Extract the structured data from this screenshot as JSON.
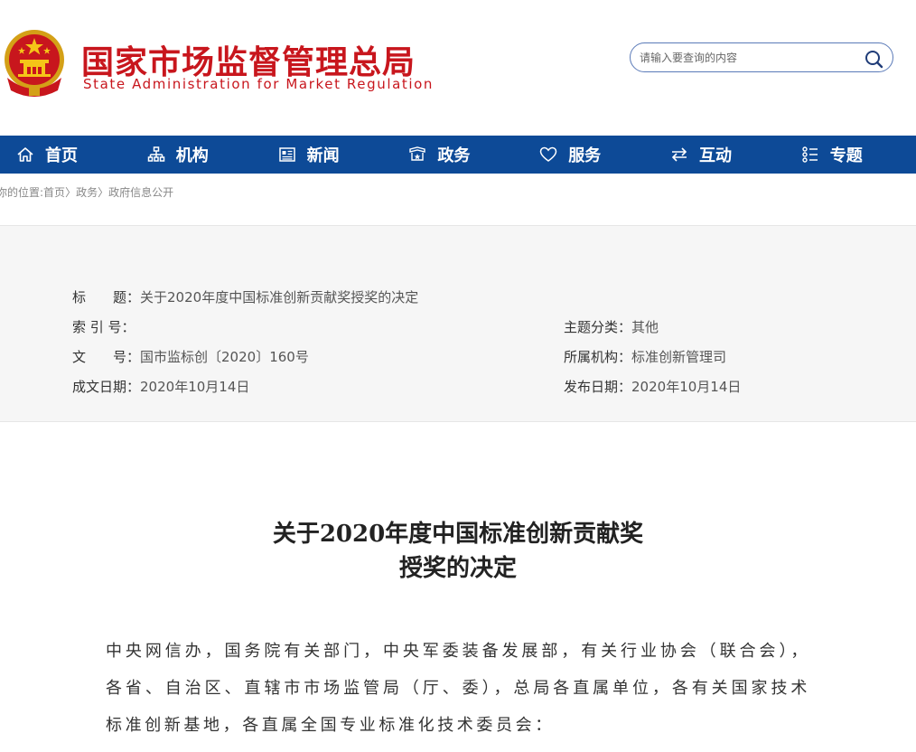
{
  "site": {
    "name_cn": "国家市场监督管理总局",
    "name_en": "State Administration for Market Regulation"
  },
  "search": {
    "placeholder": "请输入要查询的内容"
  },
  "nav": {
    "items": [
      {
        "label": "首页",
        "icon": "home-icon"
      },
      {
        "label": "机构",
        "icon": "org-chart-icon"
      },
      {
        "label": "新闻",
        "icon": "newspaper-icon"
      },
      {
        "label": "政务",
        "icon": "government-icon"
      },
      {
        "label": "服务",
        "icon": "heart-icon"
      },
      {
        "label": "互动",
        "icon": "exchange-icon"
      },
      {
        "label": "专题",
        "icon": "grid-list-icon"
      }
    ]
  },
  "breadcrumb": {
    "prefix": "你的位置:",
    "items": [
      "首页",
      "政务",
      "政府信息公开"
    ],
    "separator": "〉"
  },
  "meta": {
    "title_label": "标　　题：",
    "title_value": "关于2020年度中国标准创新贡献奖授奖的决定",
    "index_label": "索 引 号：",
    "index_value": "",
    "topic_label": "主题分类：",
    "topic_value": "其他",
    "docno_label": "文　　号：",
    "docno_value": "国市监标创〔2020〕160号",
    "dept_label": "所属机构：",
    "dept_value": "标准创新管理司",
    "written_label": "成文日期：",
    "written_value": "2020年10月14日",
    "publish_label": "发布日期：",
    "publish_value": "2020年10月14日"
  },
  "article": {
    "title_line1": "关于2020年度中国标准创新贡献奖",
    "title_line2": "授奖的决定",
    "body": "中央网信办，国务院有关部门，中央军委装备发展部，有关行业协会（联合会），各省、自治区、直辖市市场监管局（厅、委），总局各直属单位，各有关国家技术标准创新基地，各直属全国专业标准化技术委员会："
  },
  "colors": {
    "brand_red": "#c8161d",
    "nav_blue": "#0d4a97",
    "meta_bg": "#f6f6f6"
  }
}
